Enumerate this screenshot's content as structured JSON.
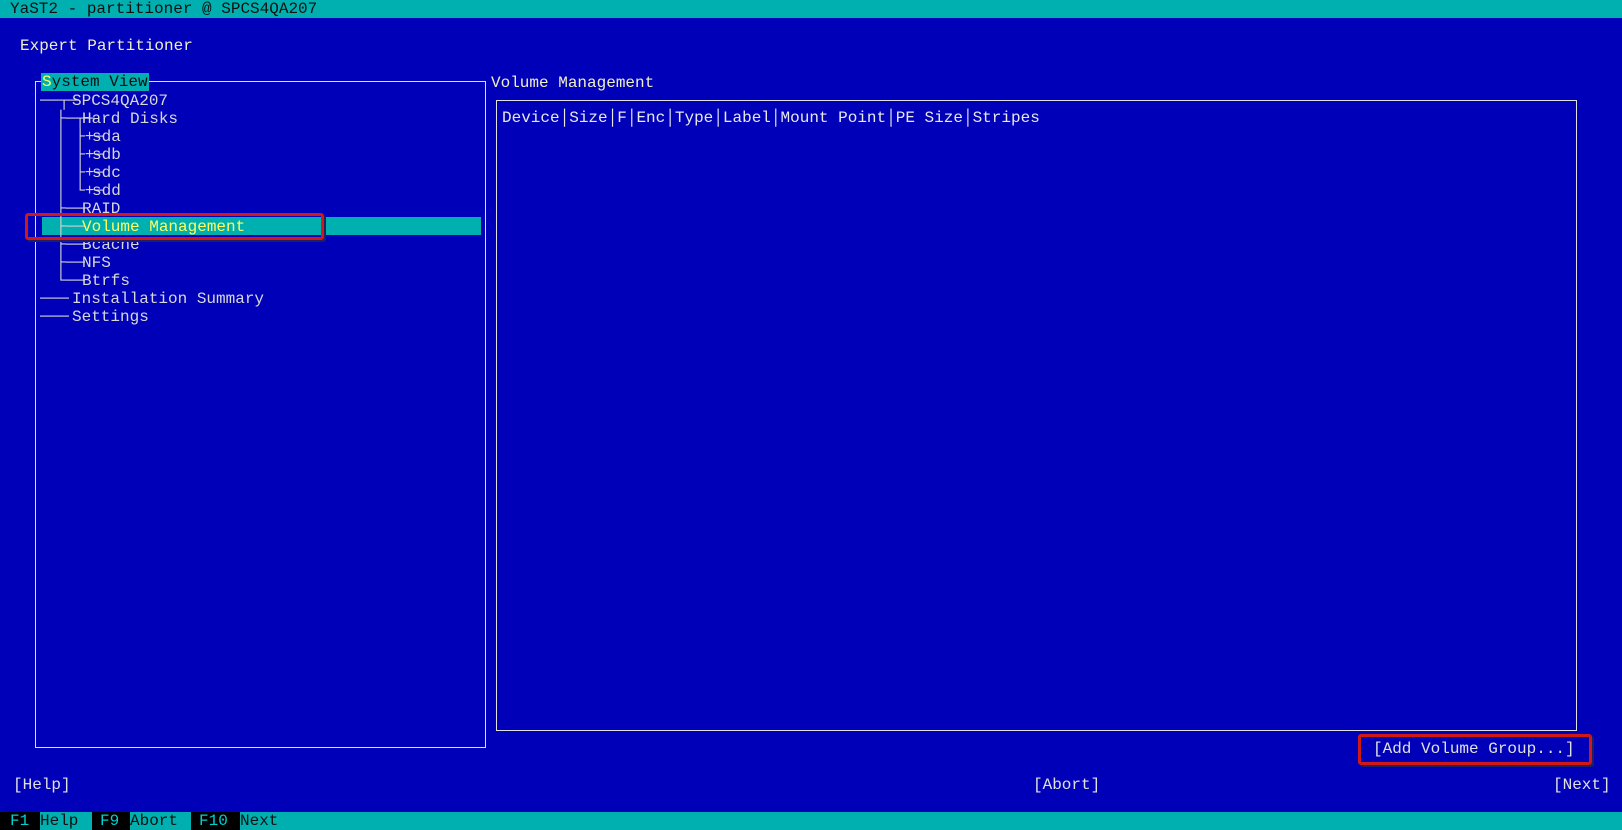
{
  "window": {
    "title": "YaST2 - partitioner @ SPCS4QA207"
  },
  "page": {
    "heading": "Expert Partitioner"
  },
  "system_view": {
    "title": "System View",
    "tree": {
      "host": "SPCS4QA207",
      "hard_disks": "Hard Disks",
      "disks": [
        "sda",
        "sdb",
        "sdc",
        "sdd"
      ],
      "raid": "RAID",
      "volume_management": "Volume Management",
      "bcache": "Bcache",
      "nfs": "NFS",
      "btrfs": "Btrfs",
      "installation_summary": "Installation Summary",
      "settings": "Settings"
    }
  },
  "main": {
    "title": "Volume Management",
    "columns": [
      "Device",
      "Size",
      "F",
      "Enc",
      "Type",
      "Label",
      "Mount Point",
      "PE Size",
      "Stripes"
    ],
    "add_button": "[Add Volume Group...]"
  },
  "footer": {
    "help": "[Help]",
    "abort": "[Abort]",
    "next": "[Next]"
  },
  "fkeys": [
    {
      "key": "F1",
      "label": "Help"
    },
    {
      "key": "F9",
      "label": "Abort"
    },
    {
      "key": "F10",
      "label": "Next"
    }
  ],
  "colors": {
    "background": "#0000b8",
    "accent": "#00b0b0",
    "highlight_outline": "#d01818",
    "hotkey": "#ffff60"
  }
}
